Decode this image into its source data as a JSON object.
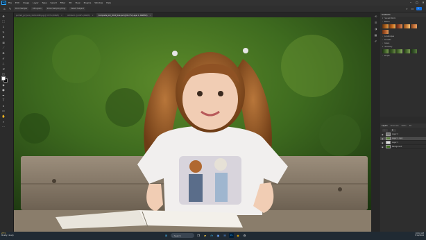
{
  "menubar": {
    "app_logo": "Ps",
    "items": [
      "File",
      "Edit",
      "Image",
      "Layer",
      "Type",
      "Select",
      "Filter",
      "3D",
      "View",
      "Plugins",
      "Window",
      "Help"
    ],
    "window_controls": [
      "minimize-icon",
      "maximize-icon",
      "close-icon"
    ]
  },
  "options_bar": {
    "sample_size": "Point Sample",
    "sample_all_layers": "All Layers",
    "show_ring": "Show Sampling Ring",
    "select_subject": "Select Subject"
  },
  "document_tabs": [
    {
      "label": "portrait_girl_book_1920x1080.jpg @ 33.3% (RGB/8)",
      "active": false
    },
    {
      "label": "Untitled-1 @ 100% (RGB/8)",
      "active": false
    },
    {
      "label": "Composite_Girl_2024_final.psd @ 66.7% (Layer 1, RGB/8#)",
      "active": true
    }
  ],
  "toolbar": {
    "tools": [
      "move-icon",
      "marquee-icon",
      "lasso-icon",
      "quick-select-icon",
      "crop-icon",
      "frame-icon",
      "eyedropper-icon",
      "spot-heal-icon",
      "brush-icon",
      "clone-stamp-icon",
      "history-brush-icon",
      "eraser-icon",
      "gradient-icon",
      "blur-icon",
      "dodge-icon",
      "pen-icon",
      "type-icon",
      "path-select-icon",
      "rectangle-icon",
      "hand-icon",
      "zoom-icon"
    ],
    "colors": {
      "foreground": "#ffffff",
      "background": "#000000"
    }
  },
  "panels": {
    "gradients": {
      "title": "Gradients",
      "subtitle": "Sunset Warm",
      "basics_label": "Basics",
      "swatches": [
        "#b0601a",
        "#c76a1c",
        "#a04c26",
        "#d0823a",
        "#c9723a",
        "#ad5a2a",
        "#e0a050"
      ],
      "groups": [
        "Landscapes",
        "Sunsets",
        "Green",
        "Greenery",
        "Purple"
      ],
      "green_swatches": [
        "#2e4a22",
        "#44662c",
        "#3a5a26",
        "#567a38",
        "#4b6e30",
        "#35522a",
        "#5a7f3c"
      ]
    },
    "layers": {
      "tabs": [
        "Layers",
        "Channels",
        "Paths",
        "3D"
      ],
      "active_tab": "Layers",
      "rows": [
        {
          "name": "Layer 2",
          "active": false
        },
        {
          "name": "Layer 1 copy",
          "active": true
        },
        {
          "name": "Layer 1",
          "active": false
        },
        {
          "name": "Background",
          "active": false
        }
      ]
    }
  },
  "taskbar": {
    "weather_temp": "25°C",
    "weather_desc": "Mostly cloudy",
    "search_placeholder": "Search",
    "apps": [
      "windows-start-icon",
      "search-icon",
      "task-view-icon",
      "file-explorer-icon",
      "edge-browser-icon",
      "store-icon",
      "mail-icon",
      "photoshop-icon",
      "chrome-icon",
      "settings-icon"
    ],
    "clock_time": "10:42 AM",
    "clock_date": "7/14/2024"
  }
}
